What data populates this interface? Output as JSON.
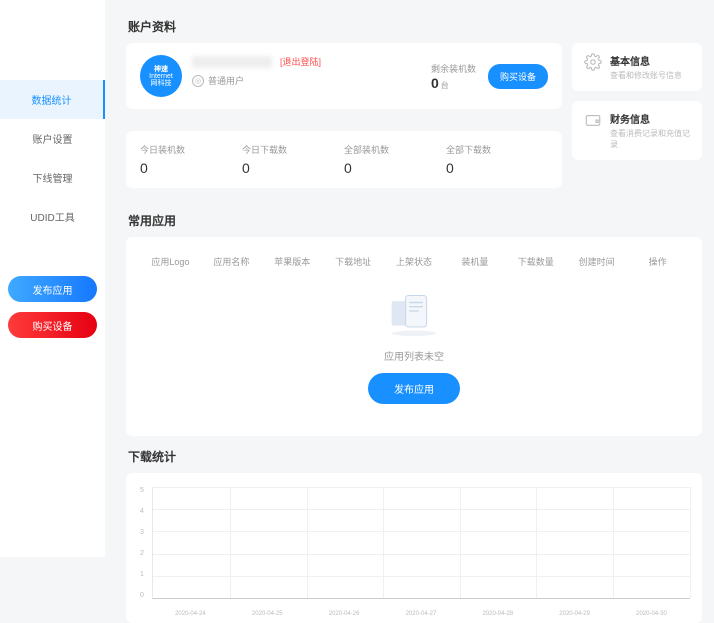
{
  "sidebar": {
    "items": [
      {
        "label": "数据统计"
      },
      {
        "label": "账户设置"
      },
      {
        "label": "下线管理"
      },
      {
        "label": "UDID工具"
      }
    ],
    "publish_label": "发布应用",
    "buy_label": "购买设备"
  },
  "account": {
    "section_title": "账户资料",
    "avatar": {
      "line1": "神速",
      "line2": "Internet",
      "line3": "网科技"
    },
    "logout_label": "[退出登陆]",
    "role_label": "普通用户",
    "balance_label": "剩余装机数",
    "balance_value": "0",
    "balance_unit": "台",
    "buy_device_label": "购买设备"
  },
  "info": [
    {
      "title": "基本信息",
      "sub": "查看和修改账号信息"
    },
    {
      "title": "财务信息",
      "sub": "查看消费记录和充值记录"
    }
  ],
  "stats": [
    {
      "label": "今日装机数",
      "value": "0"
    },
    {
      "label": "今日下载数",
      "value": "0"
    },
    {
      "label": "全部装机数",
      "value": "0"
    },
    {
      "label": "全部下载数",
      "value": "0"
    }
  ],
  "apps": {
    "section_title": "常用应用",
    "columns": [
      "应用Logo",
      "应用名称",
      "苹果版本",
      "下载地址",
      "上架状态",
      "装机量",
      "下载数量",
      "创建时间",
      "操作"
    ],
    "empty_text": "应用列表未空",
    "publish_label": "发布应用"
  },
  "chart_data": {
    "type": "bar",
    "title": "下载统计",
    "categories": [
      "2020-04-24",
      "2020-04-25",
      "2020-04-26",
      "2020-04-27",
      "2020-04-28",
      "2020-04-29",
      "2020-04-30"
    ],
    "values": [
      0,
      0,
      0,
      0,
      0,
      0,
      0
    ],
    "y_ticks": [
      5,
      4,
      3,
      2,
      1,
      0
    ],
    "ylim": [
      0,
      5
    ],
    "xlabel": "",
    "ylabel": ""
  }
}
